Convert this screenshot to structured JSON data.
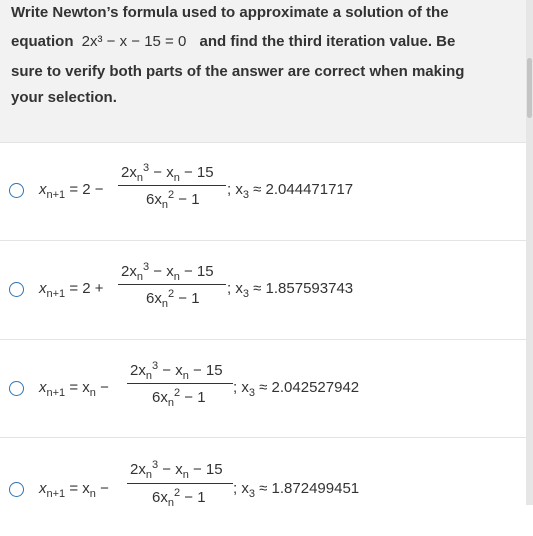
{
  "question": {
    "line1": "Write Newton’s formula used to approximate a solution of the",
    "line2_pre": "equation",
    "line2_eq": "2x³ − x − 15 = 0",
    "line2_post": "and find the third iteration value. Be",
    "line3": "sure to verify both parts of the answer are correct when making",
    "line4": "your selection."
  },
  "options": [
    {
      "lhs": "x<sub>n+1</sub> = 2 −",
      "result": "2.044471717"
    },
    {
      "lhs": "x<sub>n+1</sub> = 2 +",
      "result": "1.857593743"
    },
    {
      "lhs": "x<sub>n+1</sub> = x<sub>n</sub> −",
      "result": "2.042527942"
    },
    {
      "lhs": "x<sub>n+1</sub> = x<sub>n</sub> −",
      "result": "1.872499451"
    }
  ],
  "fraction": {
    "numerator": "2x_n³ − x_n − 15",
    "denominator": "6x_n² − 1"
  },
  "approx_label": "x₃ ≈"
}
